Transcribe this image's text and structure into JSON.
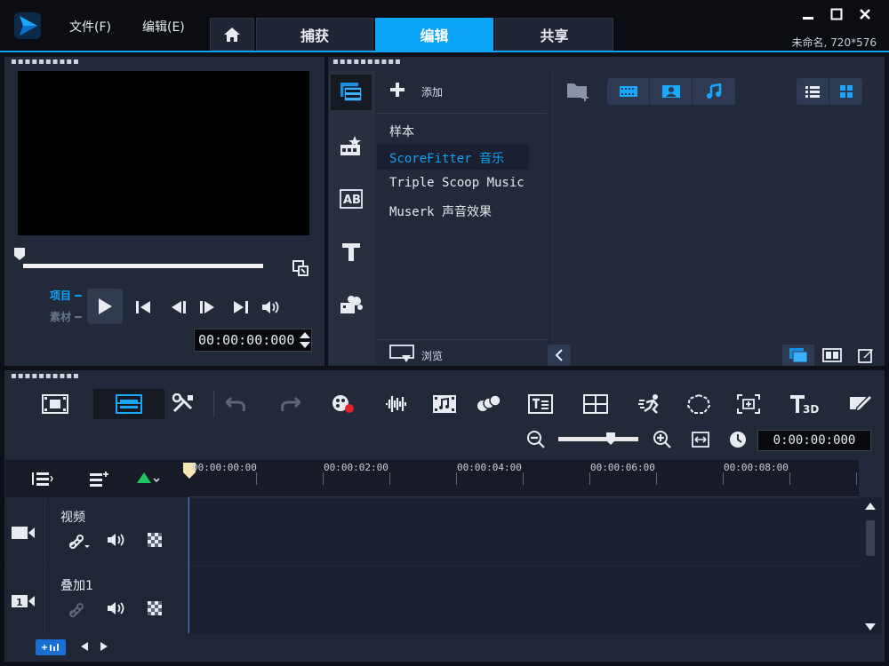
{
  "app": {
    "menus": [
      "文件(F)",
      "编辑(E)"
    ],
    "tabs": [
      "捕获",
      "编辑",
      "共享"
    ],
    "active_tab": "编辑",
    "project_info": "未命名, 720*576"
  },
  "player": {
    "mode_project": "项目",
    "mode_clip": "素材",
    "timecode": "00:00:00:000"
  },
  "library": {
    "add_label": "添加",
    "items": [
      "样本",
      "ScoreFitter 音乐",
      "Triple Scoop Music",
      "Muserk 声音效果"
    ],
    "selected_item": "ScoreFitter 音乐",
    "browse_label": "浏览"
  },
  "timeline": {
    "timecode": "0:00:00:000",
    "ruler_ticks": [
      "00:00:00:00",
      "00:00:02:00",
      "00:00:04:00",
      "00:00:06:00",
      "00:00:08:00"
    ],
    "tracks": [
      {
        "name": "视频"
      },
      {
        "name": "叠加1"
      }
    ]
  },
  "colors": {
    "accent": "#0aa3f5",
    "record_red": "#e0202a",
    "green_marker": "#22c55e"
  }
}
